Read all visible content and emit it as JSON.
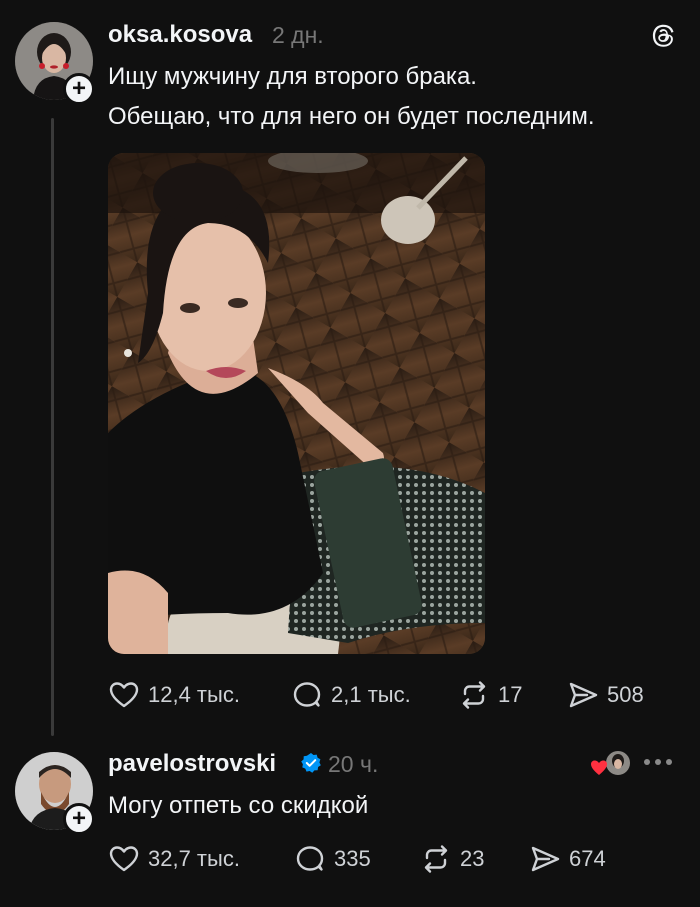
{
  "post": {
    "author": "oksa.kosova",
    "time": "2 дн.",
    "text_line1": "Ищу мужчину для второго брака.",
    "text_line2": "Обещаю, что для него он будет последним.",
    "actions": {
      "likes": "12,4 тыс.",
      "replies": "2,1 тыс.",
      "reposts": "17",
      "shares": "508"
    }
  },
  "reply": {
    "author": "pavelostrovski",
    "verified": true,
    "time": "20 ч.",
    "text": "Могу отпеть со скидкой",
    "actions": {
      "likes": "32,7 тыс.",
      "replies": "335",
      "reposts": "23",
      "shares": "674"
    }
  },
  "icons": {
    "app_logo": "threads-logo-icon",
    "like": "heart-icon",
    "reply": "speech-bubble-icon",
    "repost": "repost-icon",
    "share": "paper-plane-icon",
    "more": "more-icon",
    "follow": "plus-icon"
  },
  "colors": {
    "background": "#101010",
    "text": "#f3f5f7",
    "muted": "#777777",
    "verified": "#0095f6",
    "heart": "#ff3040"
  }
}
